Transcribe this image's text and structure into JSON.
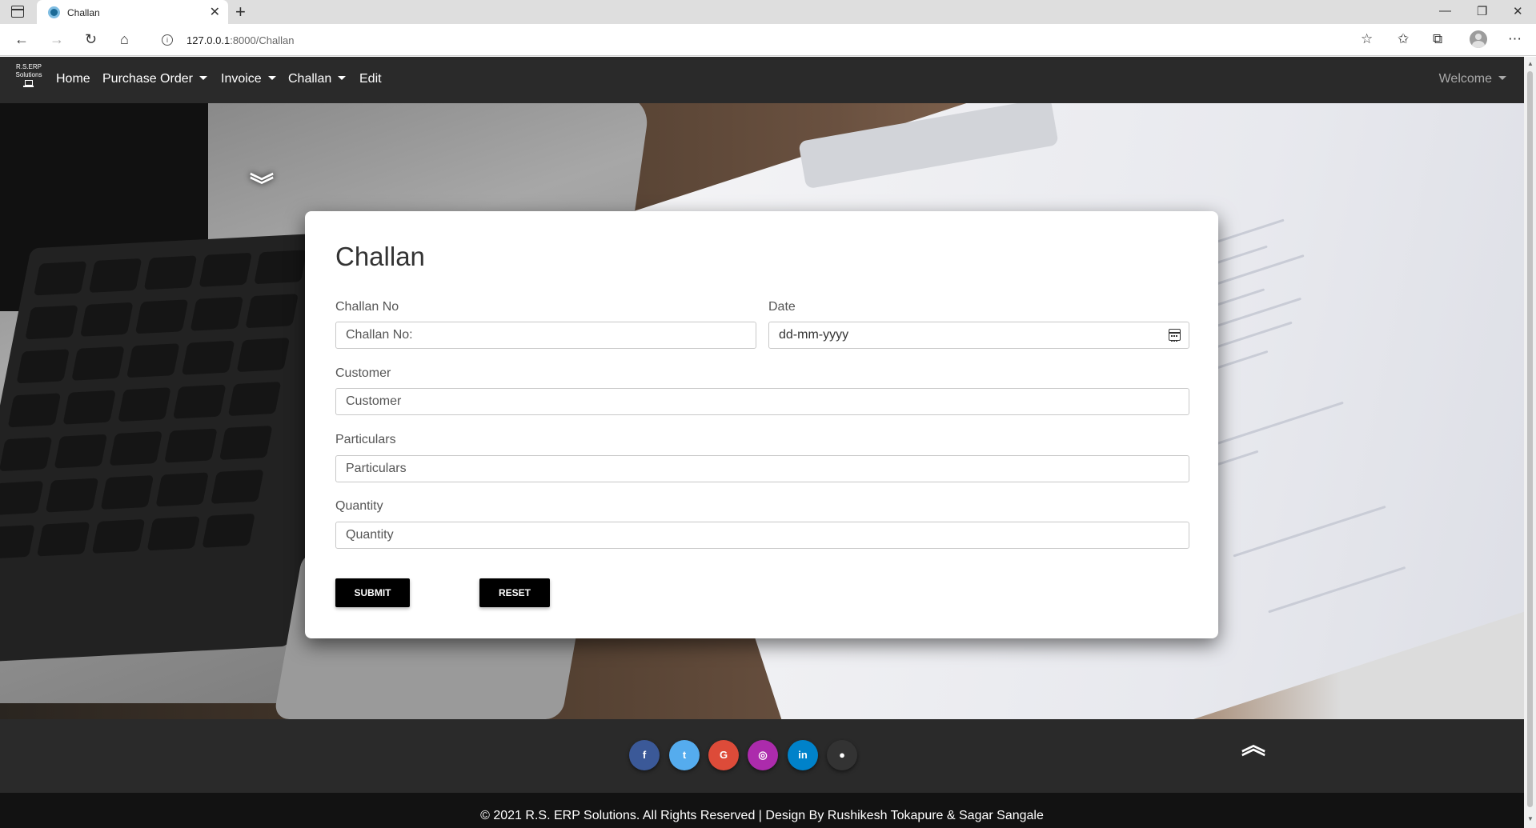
{
  "browser": {
    "tab_title": "Challan",
    "url_host": "127.0.0.1",
    "url_rest": ":8000/Challan",
    "icons": [
      "sidebar-icon",
      "back-icon",
      "forward-icon",
      "refresh-icon",
      "home-icon",
      "info-icon",
      "favorites-add-icon",
      "favorites-icon",
      "collections-icon",
      "profile-icon",
      "more-icon",
      "minimize-icon",
      "maximize-icon",
      "close-icon"
    ]
  },
  "navbar": {
    "brand_line1": "R.S.ERP",
    "brand_line2": "Solutions",
    "items": [
      {
        "label": "Home"
      },
      {
        "label": "Purchase Order"
      },
      {
        "label": "Invoice"
      },
      {
        "label": "Challan"
      },
      {
        "label": "Edit"
      }
    ],
    "welcome": "Welcome"
  },
  "form": {
    "title": "Challan",
    "challan_no_label": "Challan No",
    "challan_no_placeholder": "Challan No:",
    "date_label": "Date",
    "date_placeholder": "dd-mm-yyyy",
    "customer_label": "Customer",
    "customer_placeholder": "Customer",
    "particulars_label": "Particulars",
    "particulars_placeholder": "Particulars",
    "quantity_label": "Quantity",
    "quantity_placeholder": "Quantity",
    "submit_label": "SUBMIT",
    "reset_label": "RESET"
  },
  "footer": {
    "social": [
      {
        "name": "facebook",
        "glyph": "f",
        "color": "#3b5998"
      },
      {
        "name": "twitter",
        "glyph": "t",
        "color": "#55acee"
      },
      {
        "name": "google",
        "glyph": "G",
        "color": "#dd4b39"
      },
      {
        "name": "instagram",
        "glyph": "◎",
        "color": "#ac2bac"
      },
      {
        "name": "linkedin",
        "glyph": "in",
        "color": "#0082ca"
      },
      {
        "name": "github",
        "glyph": "●",
        "color": "#333333"
      }
    ],
    "copyright": "© 2021 R.S. ERP Solutions. All Rights Reserved | Design By Rushikesh Tokapure & Sagar Sangale"
  }
}
